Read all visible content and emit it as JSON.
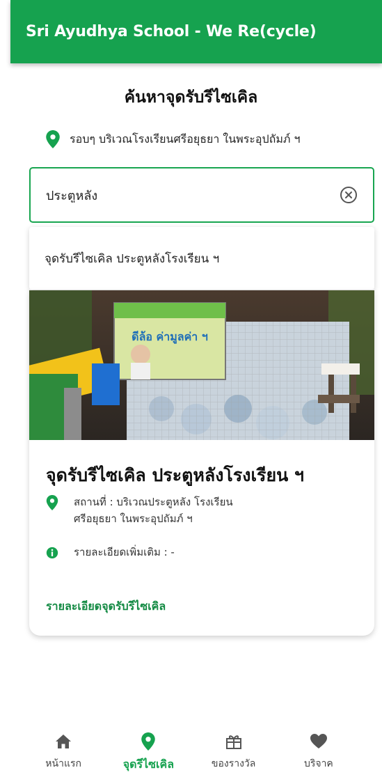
{
  "app": {
    "title": "Sri Ayudhya School - We Re(cycle)"
  },
  "page": {
    "title": "ค้นหาจุดรับรีไซเคิล",
    "location": "รอบๆ บริเวณโรงเรียนศรีอยุธยา ในพระอุปถัมภ์ ฯ"
  },
  "search": {
    "value": "ประตูหลัง",
    "placeholder": ""
  },
  "suggestions": [
    {
      "label": "จุดรับรีไซเคิล ประตูหลังโรงเรียน ฯ"
    }
  ],
  "card": {
    "title": "จุดรับรีไซเคิล ประตูหลังโรงเรียน ฯ",
    "location_line1": "สถานที่ : บริเวณประตูหลัง โรงเรียน",
    "location_line2": "ศรีอยุธยา ในพระอุปถัมภ์ ฯ",
    "info": "รายละเอียดเพิ่มเติม : -",
    "link": "รายละเอียดจุดรับรีไซเคิล",
    "photo_banner": "ดีล้อ ค่ามูลค่า ฯ"
  },
  "nav": {
    "items": [
      {
        "label": "หน้าแรก",
        "icon": "home-icon",
        "active": false
      },
      {
        "label": "จุดรีไซเคิล",
        "icon": "location-pin-icon",
        "active": true
      },
      {
        "label": "ของรางวัล",
        "icon": "gift-icon",
        "active": false
      },
      {
        "label": "บริจาค",
        "icon": "heart-icon",
        "active": false
      }
    ]
  },
  "colors": {
    "primary": "#16a24f",
    "link": "#138a43",
    "text": "#1d1d1d"
  }
}
